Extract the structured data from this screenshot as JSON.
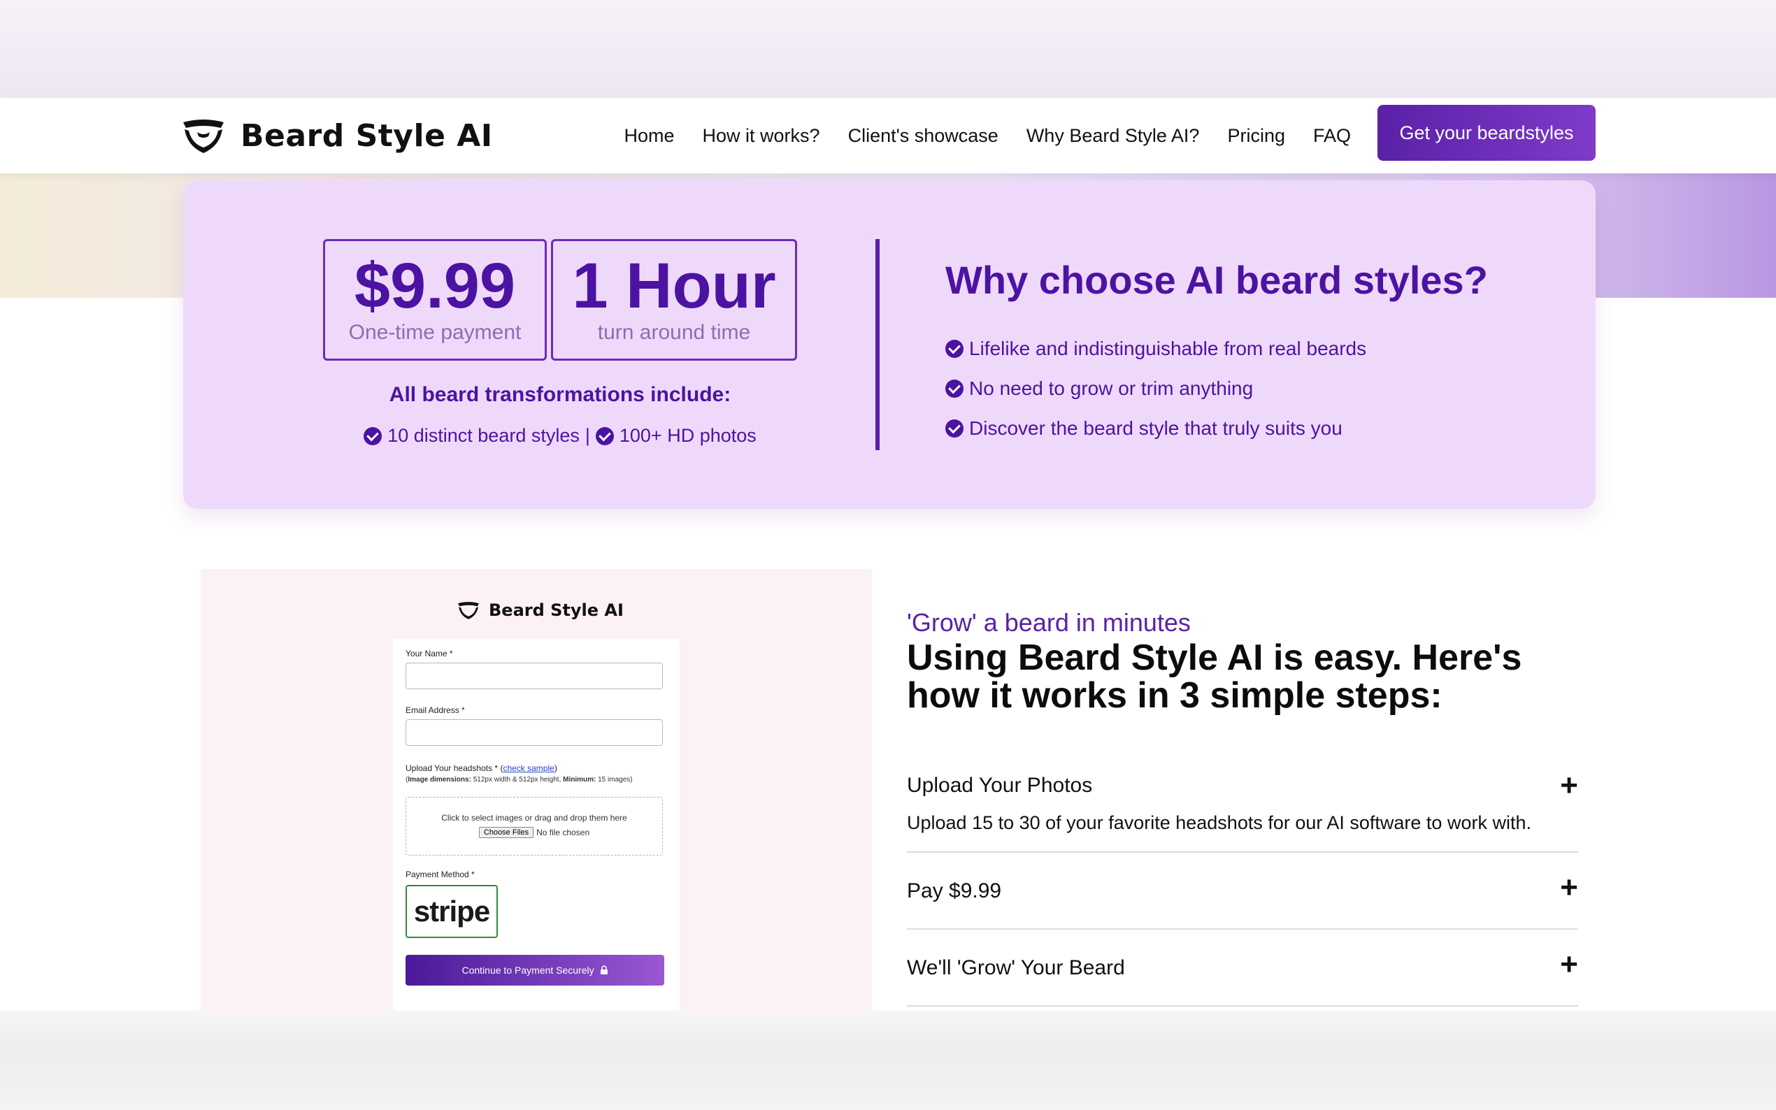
{
  "brand": {
    "name": "Beard Style AI"
  },
  "nav": {
    "links": [
      "Home",
      "How it works?",
      "Client's showcase",
      "Why Beard Style AI?",
      "Pricing",
      "FAQ"
    ],
    "cta": "Get your beardstyles"
  },
  "pricing": {
    "price": "$9.99",
    "price_sub": "One-time payment",
    "turnaround": "1 Hour",
    "turnaround_sub": "turn around time",
    "includes_title": "All beard transformations include:",
    "includes_1": "10 distinct beard styles",
    "includes_sep": "|",
    "includes_2": "100+ HD photos"
  },
  "why": {
    "title": "Why choose AI beard styles?",
    "items": [
      "Lifelike and indistinguishable from real beards",
      "No need to grow or trim anything",
      "Discover the beard style that truly suits you"
    ]
  },
  "form": {
    "brand": "Beard Style AI",
    "name_label": "Your Name *",
    "email_label": "Email Address *",
    "upload_label": "Upload Your headshots * (",
    "check_sample": "check sample",
    "upload_label_end": ")",
    "dims_bold_1": "Image dimensions:",
    "dims_text": " 512px width & 512px height, ",
    "dims_bold_2": "Minimum:",
    "dims_min": " 15 images)",
    "dims_open": "(",
    "dropzone_text": "Click to select images or drag and drop them here",
    "choose_files": "Choose Files",
    "no_file": "No file chosen",
    "payment_label": "Payment Method *",
    "stripe": "stripe",
    "pay_button": "Continue to Payment Securely"
  },
  "steps": {
    "eyebrow": "'Grow' a beard in minutes",
    "title": "Using Beard Style AI is easy. Here's how it works in 3 simple steps:",
    "items": [
      {
        "title": "Upload Your Photos",
        "body": "Upload 15 to 30 of your favorite headshots for our AI software to work with."
      },
      {
        "title": "Pay $9.99"
      },
      {
        "title": "We'll 'Grow' Your Beard"
      }
    ],
    "plus": "+"
  },
  "colors": {
    "primary": "#4c13a3",
    "card_bg": "#efd9fb",
    "mockup_bg": "#fcf1f6"
  }
}
